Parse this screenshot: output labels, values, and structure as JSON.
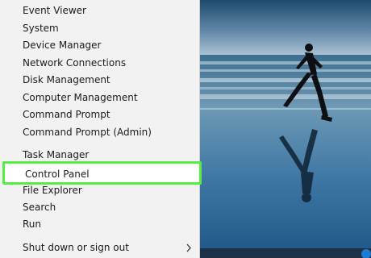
{
  "power_menu": {
    "items": [
      {
        "label": "Event Viewer"
      },
      {
        "label": "System"
      },
      {
        "label": "Device Manager"
      },
      {
        "label": "Network Connections"
      },
      {
        "label": "Disk Management"
      },
      {
        "label": "Computer Management"
      },
      {
        "label": "Command Prompt"
      },
      {
        "label": "Command Prompt (Admin)"
      },
      {
        "label": "Task Manager"
      },
      {
        "label": "Control Panel"
      },
      {
        "label": "File Explorer"
      },
      {
        "label": "Search"
      },
      {
        "label": "Run"
      },
      {
        "label": "Shut down or sign out"
      }
    ],
    "highlighted_item": "Control Panel",
    "highlight_color": "#56ed45",
    "submenu_icon": "chevron-right-icon"
  },
  "wallpaper": {
    "subject": "runner-on-beach"
  },
  "colors": {
    "menu_background": "#f2f2f2",
    "menu_text": "#1b1b1b",
    "highlight_border": "#56ed45"
  }
}
